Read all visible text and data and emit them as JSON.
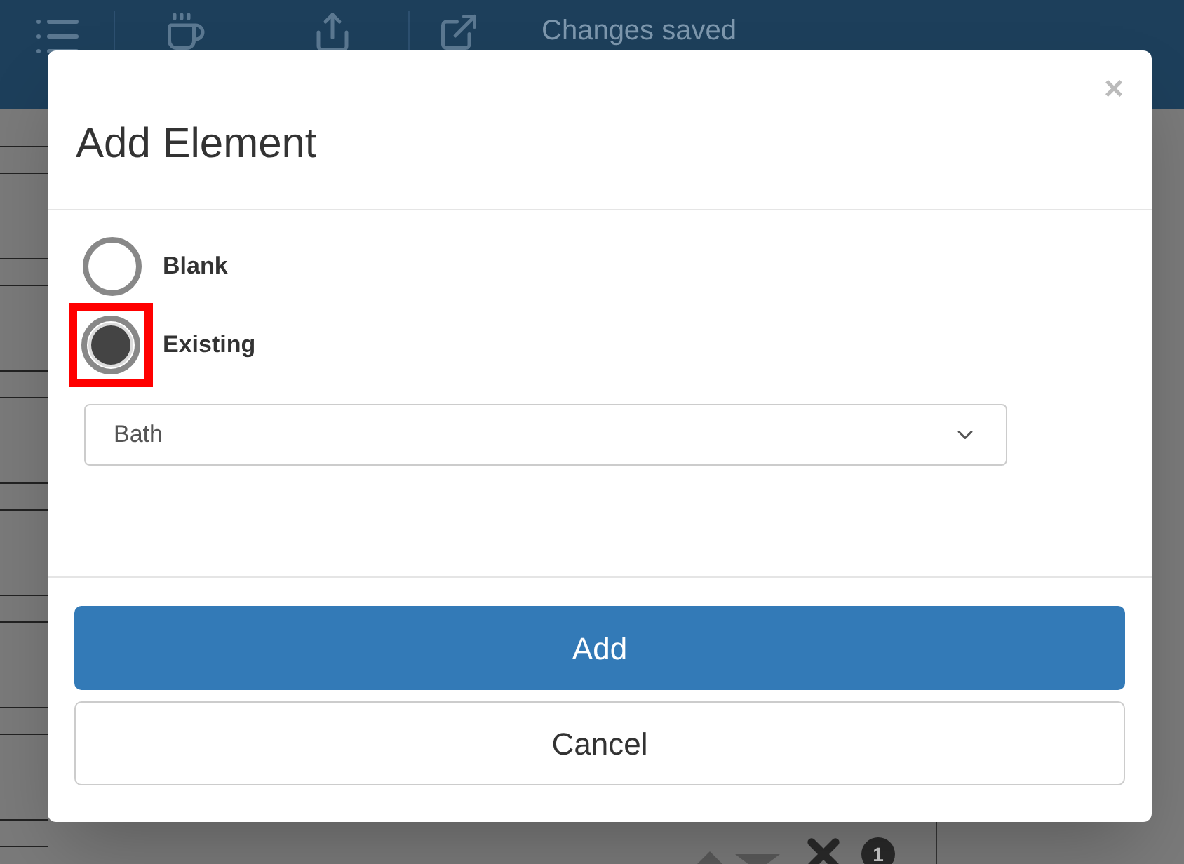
{
  "toolbar": {
    "status": "Changes saved"
  },
  "background": {
    "badge": "1"
  },
  "dialog": {
    "title": "Add Element",
    "close": "×",
    "options": [
      {
        "label": "Blank",
        "selected": false,
        "highlighted": false
      },
      {
        "label": "Existing",
        "selected": true,
        "highlighted": true
      }
    ],
    "select": {
      "value": "Bath"
    },
    "buttons": [
      {
        "label": "Add",
        "kind": "primary"
      },
      {
        "label": "Cancel",
        "kind": "default"
      }
    ]
  }
}
